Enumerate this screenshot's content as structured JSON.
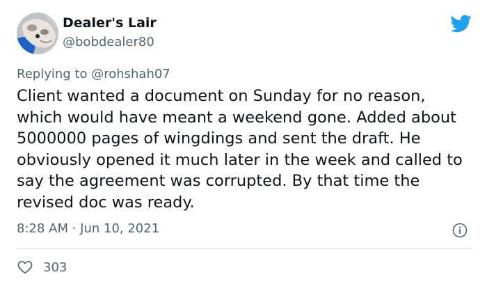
{
  "tweet": {
    "author": {
      "display_name": "Dealer's Lair",
      "handle": "@bobdealer80",
      "avatar_icon": "dog-avatar"
    },
    "reply": {
      "prefix": "Replying to ",
      "mention": "@rohshah07"
    },
    "body": "Client wanted a document on Sunday for no reason, which would have meant a weekend gone. Added about 5000000 pages of wingdings and sent the draft. He obviously opened it much later in the week and called to say the agreement was corrupted. By that time the revised doc was ready.",
    "timestamp": "8:28 AM · Jun 10, 2021",
    "likes": "303"
  },
  "icons": {
    "brand": "twitter-bird-icon",
    "info": "info-icon",
    "like": "heart-icon"
  },
  "colors": {
    "twitter_blue": "#1da1f2",
    "secondary_text": "#536471",
    "primary_text": "#0f1419",
    "divider": "#cfd9de"
  }
}
